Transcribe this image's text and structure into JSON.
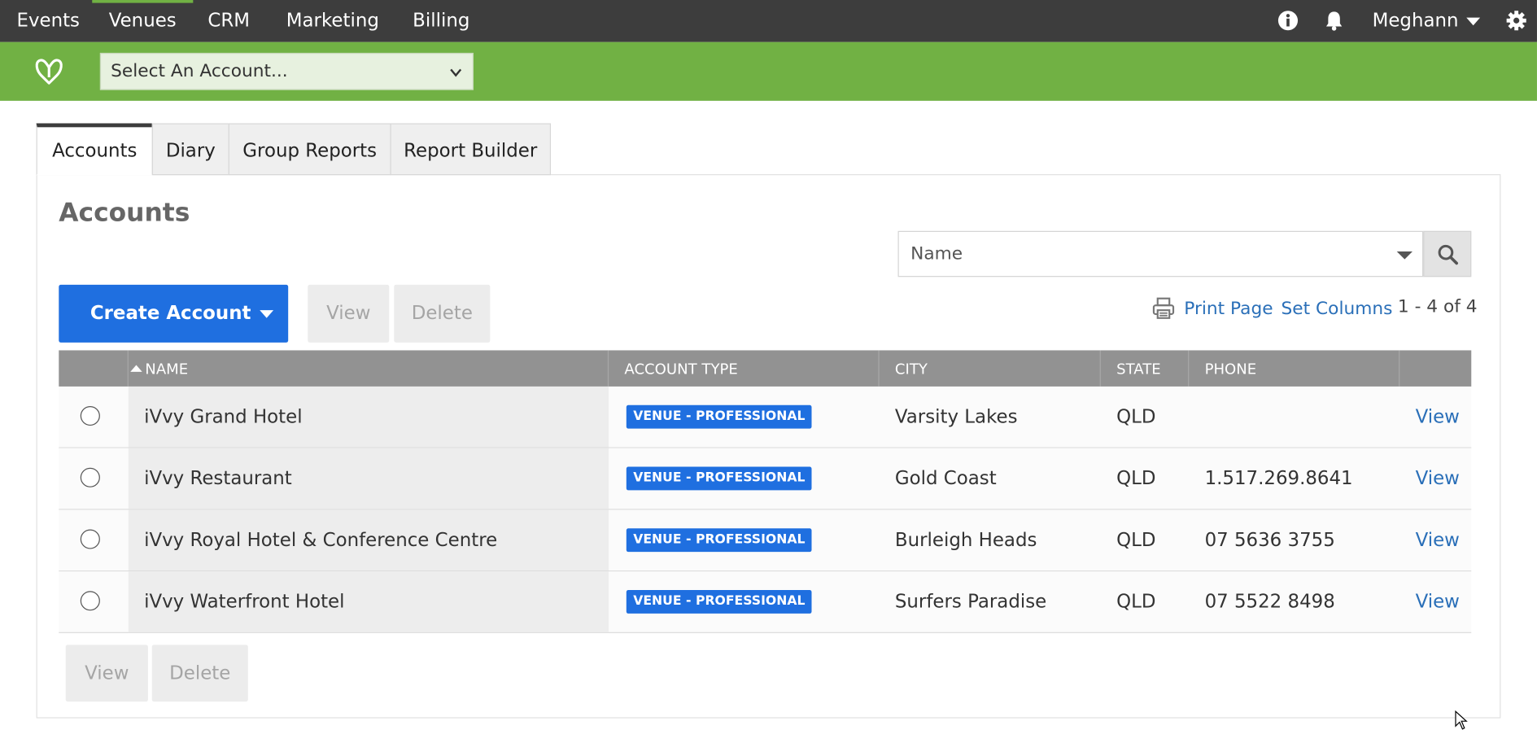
{
  "topnav": {
    "items": [
      {
        "label": "Events"
      },
      {
        "label": "Venues"
      },
      {
        "label": "CRM"
      },
      {
        "label": "Marketing"
      },
      {
        "label": "Billing"
      }
    ],
    "active": "Venues",
    "user": "Meghann",
    "icons": [
      "info-icon",
      "bell-icon",
      "gear-icon"
    ]
  },
  "accountbar": {
    "select_value": "Select An Account...",
    "logo": "ivvy-logo-icon"
  },
  "tabs": [
    {
      "label": "Accounts",
      "active": true
    },
    {
      "label": "Diary",
      "active": false
    },
    {
      "label": "Group Reports",
      "active": false
    },
    {
      "label": "Report Builder",
      "active": false
    }
  ],
  "page": {
    "title": "Accounts",
    "search_field": "Name",
    "create_label": "Create Account",
    "view_label": "View",
    "delete_label": "Delete",
    "print_label": "Print Page",
    "set_columns_label": "Set Columns",
    "count": "1 - 4 of 4"
  },
  "table": {
    "columns": [
      "NAME",
      "ACCOUNT TYPE",
      "CITY",
      "STATE",
      "PHONE"
    ],
    "rows": [
      {
        "name": "iVvy Grand Hotel",
        "type": "VENUE - PROFESSIONAL",
        "city": "Varsity Lakes",
        "state": "QLD",
        "phone": "",
        "action": "View"
      },
      {
        "name": "iVvy Restaurant",
        "type": "VENUE - PROFESSIONAL",
        "city": "Gold Coast",
        "state": "QLD",
        "phone": "1.517.269.8641",
        "action": "View"
      },
      {
        "name": "iVvy Royal Hotel & Conference Centre",
        "type": "VENUE - PROFESSIONAL",
        "city": "Burleigh Heads",
        "state": "QLD",
        "phone": "07 5636 3755",
        "action": "View"
      },
      {
        "name": "iVvy Waterfront Hotel",
        "type": "VENUE - PROFESSIONAL",
        "city": "Surfers Paradise",
        "state": "QLD",
        "phone": "07 5522 8498",
        "action": "View"
      }
    ]
  },
  "colors": {
    "topbar": "#3d3d3d",
    "green": "#71b144",
    "primary": "#1f6fe0",
    "link": "#2a6fb8"
  }
}
